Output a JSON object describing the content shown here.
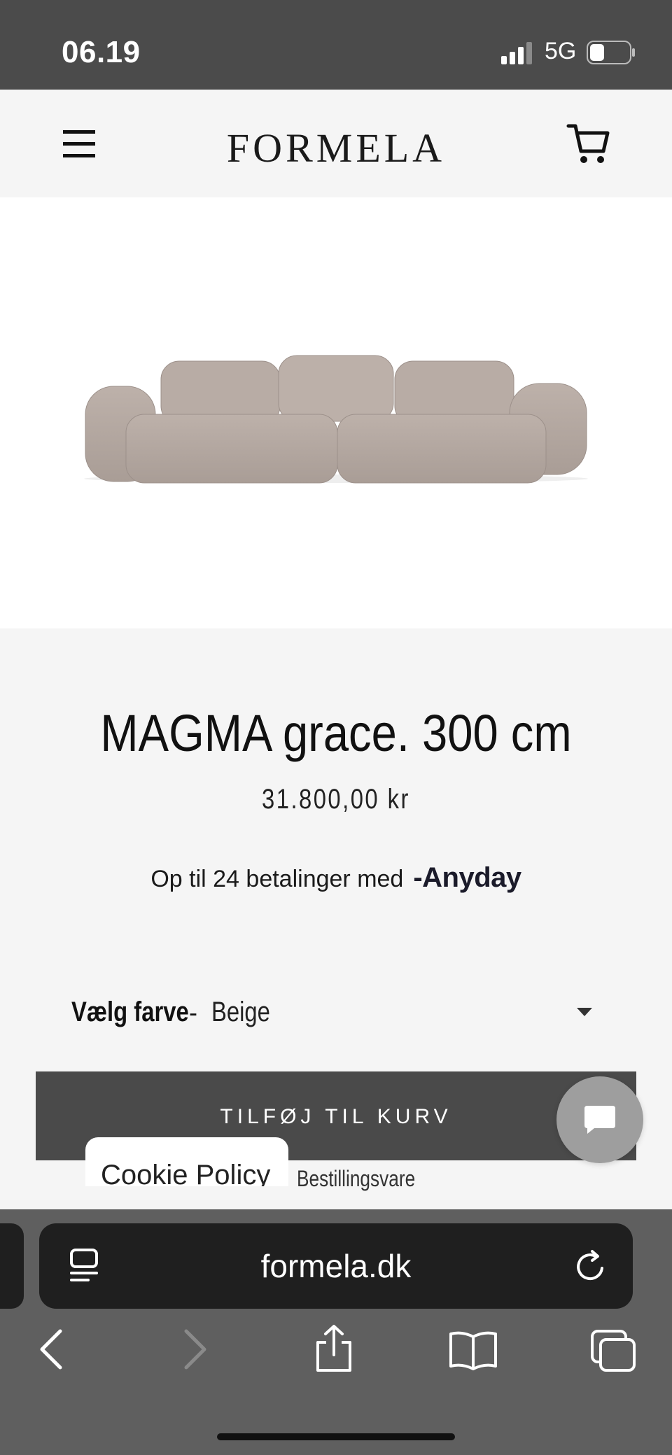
{
  "status_bar": {
    "time": "06.19",
    "network": "5G"
  },
  "header": {
    "logo": "FORMELA"
  },
  "product": {
    "title": "MAGMA grace. 300 cm",
    "price": "31.800,00 kr",
    "installments_text": "Op til 24 betalinger med",
    "installments_provider": "-Anyday",
    "variant_label": "Vælg farve",
    "variant_separator": "-",
    "variant_value": "Beige",
    "add_to_cart_label": "TILFØJ TIL KURV",
    "order_note": "Bestillingsvare"
  },
  "cookie": {
    "label": "Cookie Policy"
  },
  "browser": {
    "url": "formela.dk"
  },
  "colors": {
    "status_bar_bg": "#4b4b4b",
    "page_bg": "#f5f5f5",
    "button_bg": "#4a4a4a",
    "chat_bg": "#9e9e9e",
    "browser_bg": "#5f5f5f",
    "sofa": "#b5a9a2"
  },
  "icons": {
    "menu": "hamburger-icon",
    "cart": "shopping-cart-icon",
    "chat": "chat-bubble-icon",
    "reader": "reader-view-icon",
    "reload": "reload-icon",
    "back": "chevron-left-icon",
    "forward": "chevron-right-icon",
    "share": "share-icon",
    "bookmarks": "book-icon",
    "tabs": "tabs-icon"
  }
}
